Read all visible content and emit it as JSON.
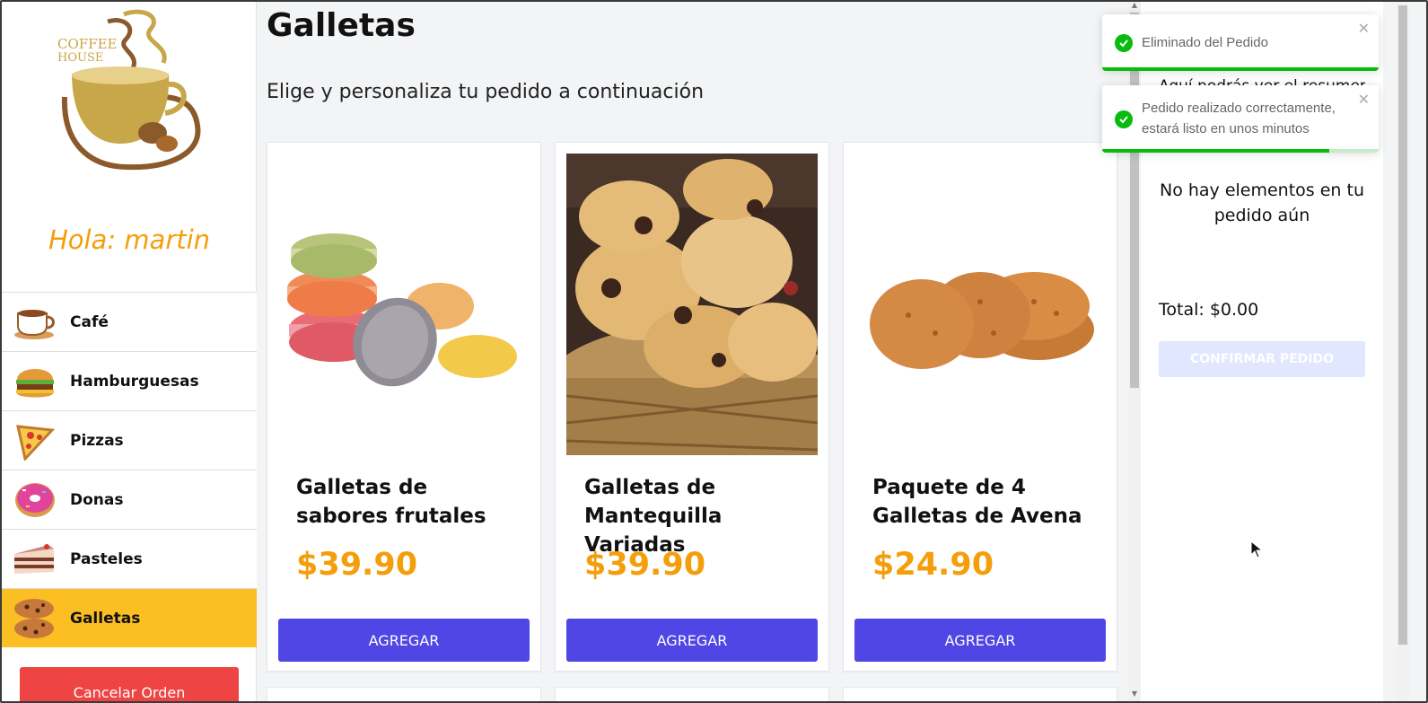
{
  "sidebar": {
    "logo_text_line1": "COFFEE",
    "logo_text_line2": "HOUSE",
    "greeting": "Hola: martin",
    "categories": [
      {
        "label": "Café",
        "icon": "coffee-cup-icon"
      },
      {
        "label": "Hamburguesas",
        "icon": "burger-icon"
      },
      {
        "label": "Pizzas",
        "icon": "pizza-slice-icon"
      },
      {
        "label": "Donas",
        "icon": "donut-icon"
      },
      {
        "label": "Pasteles",
        "icon": "cake-slice-icon"
      },
      {
        "label": "Galletas",
        "icon": "cookies-icon",
        "active": true
      }
    ],
    "cancel_label": "Cancelar Orden"
  },
  "main": {
    "title": "Galletas",
    "subtitle": "Elige y personaliza tu pedido a continuación",
    "products": [
      {
        "name": "Galletas de sabores frutales",
        "price": "$39.90",
        "button": "AGREGAR",
        "image": "macarons-image"
      },
      {
        "name": "Galletas de Mantequilla Variadas",
        "price": "$39.90",
        "button": "AGREGAR",
        "image": "butter-cookies-basket-image"
      },
      {
        "name": "Paquete de 4 Galletas de Avena",
        "price": "$24.90",
        "button": "AGREGAR",
        "image": "oatmeal-cookies-image"
      }
    ]
  },
  "summary": {
    "hint": "Aquí podrás ver el resumen y",
    "empty": "No hay elementos en tu pedido aún",
    "total": "Total: $0.00",
    "confirm_label": "CONFIRMAR PEDIDO"
  },
  "toasts": [
    {
      "message": "Eliminado del Pedido",
      "progress": 1.0
    },
    {
      "message": "Pedido realizado correctamente, estará listo en unos minutos",
      "progress": 0.82
    }
  ],
  "colors": {
    "accent_yellow": "#fbbf24",
    "price_orange": "#f59e0b",
    "primary_indigo": "#4f46e5",
    "danger_red": "#ef4444",
    "success_green": "#07bc0c"
  }
}
